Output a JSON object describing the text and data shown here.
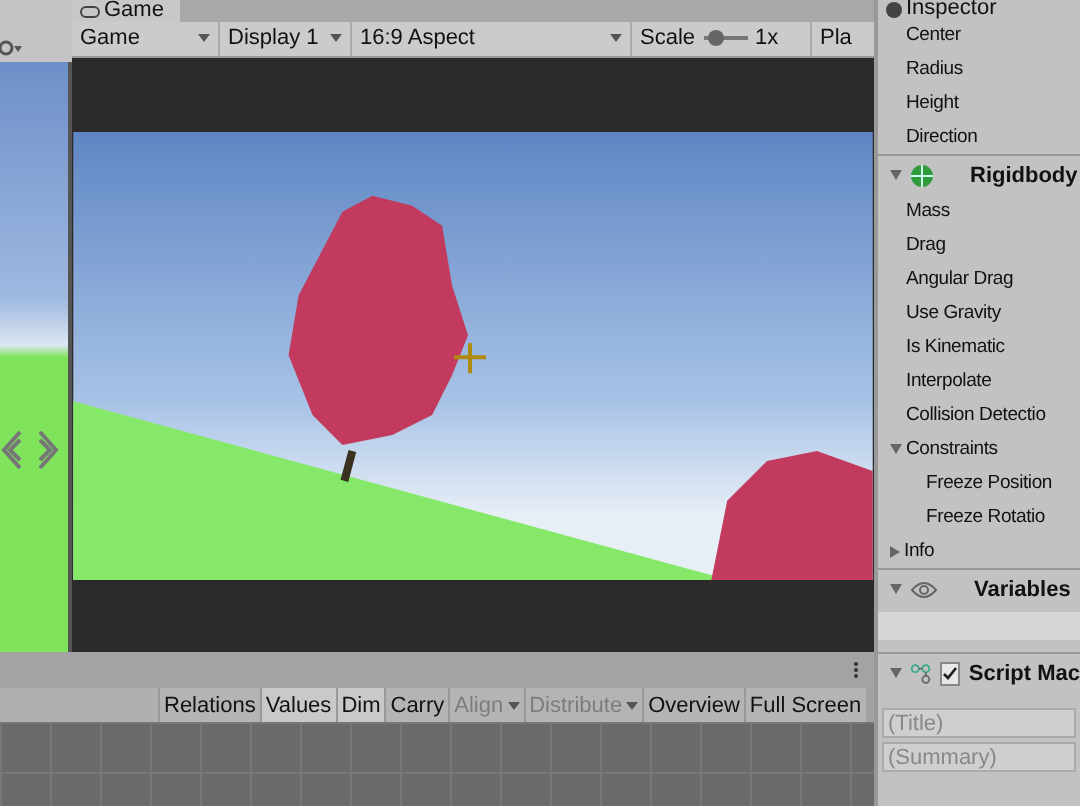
{
  "game_tab": {
    "label": "Game"
  },
  "game_toolbar": [
    {
      "kind": "dropdown",
      "label": "Game"
    },
    {
      "kind": "dropdown",
      "label": "Display 1"
    },
    {
      "kind": "dropdown",
      "label": "16:9 Aspect"
    },
    {
      "kind": "slider",
      "label": "Scale",
      "level": 0.15,
      "reading": "1x"
    },
    {
      "kind": "button",
      "label": "Pla"
    }
  ],
  "inspector": {
    "title": "Inspector",
    "fields": [
      "Center",
      "Radius",
      "Height",
      "Direction"
    ],
    "components": [
      {
        "kind": "rigidbody",
        "title": "Rigidbody",
        "expanded": true,
        "fields": [
          {
            "label": "Mass"
          },
          {
            "label": "Drag"
          },
          {
            "label": "Angular Drag"
          },
          {
            "label": "Use Gravity"
          },
          {
            "label": "Is Kinematic"
          },
          {
            "label": "Interpolate"
          },
          {
            "label": "Collision Detectio"
          },
          {
            "label": "Constraints",
            "expanded": true,
            "children": [
              {
                "label": "Freeze Position"
              },
              {
                "label": "Freeze Rotatio"
              }
            ]
          },
          {
            "label": "Info",
            "expanded": false
          }
        ]
      },
      {
        "kind": "variables",
        "title": "Variables",
        "expanded": true
      },
      {
        "kind": "script",
        "title": "Script Mac",
        "expanded": true,
        "checked": true,
        "inputs": [
          {
            "placeholder": "(Title)"
          },
          {
            "placeholder": "(Summary)"
          }
        ]
      }
    ]
  },
  "bottom_toolbar": [
    {
      "label": "Relations",
      "selected": false,
      "disabled": false,
      "dropdown": false
    },
    {
      "label": "Values",
      "selected": true,
      "disabled": false,
      "dropdown": false
    },
    {
      "label": "Dim",
      "selected": true,
      "disabled": false,
      "dropdown": false
    },
    {
      "label": "Carry",
      "selected": false,
      "disabled": false,
      "dropdown": false
    },
    {
      "label": "Align",
      "selected": false,
      "disabled": true,
      "dropdown": true
    },
    {
      "label": "Distribute",
      "selected": false,
      "disabled": true,
      "dropdown": true
    },
    {
      "label": "Overview",
      "selected": false,
      "disabled": false,
      "dropdown": false
    },
    {
      "label": "Full Screen",
      "selected": false,
      "disabled": false,
      "dropdown": false
    }
  ]
}
